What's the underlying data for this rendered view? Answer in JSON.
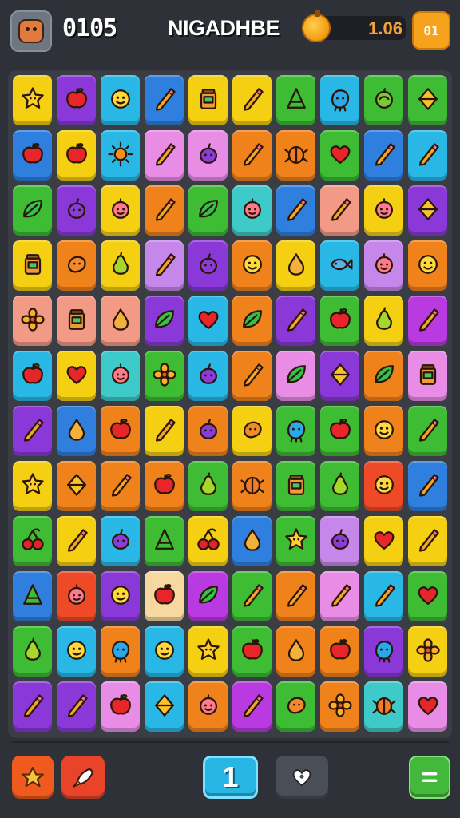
{
  "header": {
    "left_counter": "0105",
    "title": "NIGADHBE",
    "coin_value": "1.06",
    "menu_label": "01",
    "avatar_icon": "fox-face-icon",
    "coin_icon": "fruit-coin-icon"
  },
  "palette": {
    "yellow": "#f4cf12",
    "purple": "#8a39d8",
    "sky": "#29b8e6",
    "blue": "#2f7fde",
    "green": "#3dbc34",
    "orange": "#f0821c",
    "pink": "#e88ce6",
    "red": "#ee4a28",
    "lavender": "#c587ea",
    "teal": "#3ecac8",
    "lime": "#90d92a",
    "salmon": "#f29a86",
    "magenta": "#b93ae0",
    "cream": "#f7d8a0"
  },
  "board": {
    "rows": [
      [
        [
          "yellow",
          "star-face-icon"
        ],
        [
          "purple",
          "apple-icon"
        ],
        [
          "sky",
          "smiley-icon"
        ],
        [
          "blue",
          "pencil-icon"
        ],
        [
          "yellow",
          "jar-icon"
        ],
        [
          "yellow",
          "pencil-icon"
        ],
        [
          "green",
          "cone-icon"
        ],
        [
          "sky",
          "blob-icon"
        ],
        [
          "green",
          "fruit-icon"
        ],
        [
          "green",
          "gem-icon"
        ]
      ],
      [
        [
          "blue",
          "apple-icon"
        ],
        [
          "yellow",
          "apple-icon"
        ],
        [
          "sky",
          "sun-icon"
        ],
        [
          "pink",
          "pencil-icon"
        ],
        [
          "pink",
          "plum-icon"
        ],
        [
          "orange",
          "pencil-icon"
        ],
        [
          "orange",
          "bug-icon"
        ],
        [
          "green",
          "heart-icon"
        ],
        [
          "blue",
          "pencil-icon"
        ],
        [
          "sky",
          "pencil-icon"
        ]
      ],
      [
        [
          "green",
          "leaf-icon"
        ],
        [
          "purple",
          "plum-icon"
        ],
        [
          "yellow",
          "peach-icon"
        ],
        [
          "orange",
          "pencil-icon"
        ],
        [
          "green",
          "leaf-icon"
        ],
        [
          "teal",
          "peach-icon"
        ],
        [
          "blue",
          "pencil-icon"
        ],
        [
          "salmon",
          "pencil-icon"
        ],
        [
          "yellow",
          "peach-icon"
        ],
        [
          "purple",
          "gem-icon"
        ]
      ],
      [
        [
          "yellow",
          "jar-icon"
        ],
        [
          "orange",
          "bean-icon"
        ],
        [
          "yellow",
          "pear-icon"
        ],
        [
          "lavender",
          "pencil-icon"
        ],
        [
          "purple",
          "plum-icon"
        ],
        [
          "orange",
          "smiley-icon"
        ],
        [
          "yellow",
          "drop-icon"
        ],
        [
          "sky",
          "fish-icon"
        ],
        [
          "lavender",
          "peach-icon"
        ],
        [
          "orange",
          "smiley-icon"
        ]
      ],
      [
        [
          "salmon",
          "flower-icon"
        ],
        [
          "salmon",
          "jar-icon"
        ],
        [
          "salmon",
          "drop-icon"
        ],
        [
          "purple",
          "leaf-icon"
        ],
        [
          "sky",
          "heart-icon"
        ],
        [
          "orange",
          "leaf-icon"
        ],
        [
          "purple",
          "pencil-icon"
        ],
        [
          "green",
          "apple-icon"
        ],
        [
          "yellow",
          "pear-icon"
        ],
        [
          "magenta",
          "pencil-icon"
        ]
      ],
      [
        [
          "sky",
          "apple-icon"
        ],
        [
          "yellow",
          "heart-icon"
        ],
        [
          "teal",
          "peach-icon"
        ],
        [
          "green",
          "flower-icon"
        ],
        [
          "sky",
          "plum-icon"
        ],
        [
          "orange",
          "pencil-icon"
        ],
        [
          "pink",
          "leaf-icon"
        ],
        [
          "purple",
          "gem-icon"
        ],
        [
          "orange",
          "leaf-icon"
        ],
        [
          "pink",
          "jar-icon"
        ]
      ],
      [
        [
          "purple",
          "pencil-icon"
        ],
        [
          "blue",
          "drop-icon"
        ],
        [
          "orange",
          "apple-icon"
        ],
        [
          "yellow",
          "pencil-icon"
        ],
        [
          "orange",
          "plum-icon"
        ],
        [
          "yellow",
          "bean-icon"
        ],
        [
          "green",
          "blob-icon"
        ],
        [
          "green",
          "apple-icon"
        ],
        [
          "orange",
          "smiley-icon"
        ],
        [
          "green",
          "pencil-icon"
        ]
      ],
      [
        [
          "yellow",
          "star-face-icon"
        ],
        [
          "orange",
          "gem-icon"
        ],
        [
          "orange",
          "pencil-icon"
        ],
        [
          "orange",
          "apple-icon"
        ],
        [
          "green",
          "pear-icon"
        ],
        [
          "orange",
          "bug-icon"
        ],
        [
          "green",
          "jar-icon"
        ],
        [
          "green",
          "pear-icon"
        ],
        [
          "red",
          "smiley-icon"
        ],
        [
          "blue",
          "pencil-icon"
        ]
      ],
      [
        [
          "green",
          "cherry-icon"
        ],
        [
          "yellow",
          "pencil-icon"
        ],
        [
          "sky",
          "plum-icon"
        ],
        [
          "green",
          "cone-icon"
        ],
        [
          "yellow",
          "cherry-icon"
        ],
        [
          "blue",
          "drop-icon"
        ],
        [
          "green",
          "star-face-icon"
        ],
        [
          "lavender",
          "plum-icon"
        ],
        [
          "yellow",
          "heart-icon"
        ],
        [
          "yellow",
          "pencil-icon"
        ]
      ],
      [
        [
          "blue",
          "cone-icon"
        ],
        [
          "red",
          "peach-icon"
        ],
        [
          "purple",
          "smiley-icon"
        ],
        [
          "cream",
          "apple-icon"
        ],
        [
          "magenta",
          "leaf-icon"
        ],
        [
          "green",
          "pencil-icon"
        ],
        [
          "orange",
          "pencil-icon"
        ],
        [
          "pink",
          "pencil-icon"
        ],
        [
          "sky",
          "pencil-icon"
        ],
        [
          "green",
          "heart-icon"
        ]
      ],
      [
        [
          "green",
          "pear-icon"
        ],
        [
          "sky",
          "smiley-icon"
        ],
        [
          "orange",
          "blob-icon"
        ],
        [
          "sky",
          "smiley-icon"
        ],
        [
          "yellow",
          "star-face-icon"
        ],
        [
          "green",
          "apple-icon"
        ],
        [
          "orange",
          "drop-icon"
        ],
        [
          "orange",
          "apple-icon"
        ],
        [
          "purple",
          "blob-icon"
        ],
        [
          "yellow",
          "flower-icon"
        ]
      ],
      [
        [
          "purple",
          "pencil-icon"
        ],
        [
          "purple",
          "pencil-icon"
        ],
        [
          "pink",
          "apple-icon"
        ],
        [
          "sky",
          "gem-icon"
        ],
        [
          "orange",
          "peach-icon"
        ],
        [
          "magenta",
          "pencil-icon"
        ],
        [
          "green",
          "bean-icon"
        ],
        [
          "orange",
          "flower-icon"
        ],
        [
          "teal",
          "bug-icon"
        ],
        [
          "pink",
          "heart-icon"
        ]
      ]
    ]
  },
  "footer": {
    "left_button_icon": "fruit-bunch-icon",
    "hint_button_icon": "rocket-icon",
    "level_number": "1",
    "favorite_icon": "heart-icon",
    "menu_icon": "equals-icon"
  }
}
